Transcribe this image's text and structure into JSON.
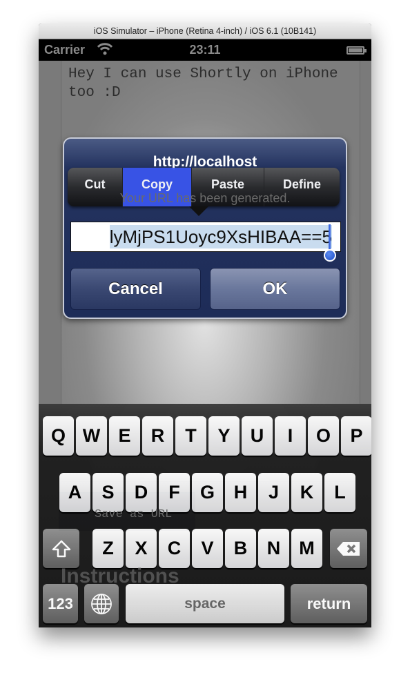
{
  "window": {
    "title": "iOS Simulator – iPhone (Retina 4-inch) / iOS 6.1 (10B141)"
  },
  "status_bar": {
    "carrier": "Carrier",
    "time": "23:11",
    "wifi_icon": "wifi-icon",
    "battery_icon": "battery-icon"
  },
  "background": {
    "text": "Hey I can use Shortly on iPhone too :D",
    "save_button": "Save as URL",
    "heading": "Instructions"
  },
  "alert": {
    "title": "http://localhost",
    "message": "Your URL has been generated.",
    "field_value": "lyMjPS1Uoyc9XsHIBAA==5",
    "cancel": "Cancel",
    "ok": "OK"
  },
  "edit_menu": {
    "items": [
      "Cut",
      "Copy",
      "Paste",
      "Define"
    ],
    "selected": "Copy",
    "selected_color": "#3a56f0"
  },
  "keyboard": {
    "row1": [
      "Q",
      "W",
      "E",
      "R",
      "T",
      "Y",
      "U",
      "I",
      "O",
      "P"
    ],
    "row2": [
      "A",
      "S",
      "D",
      "F",
      "G",
      "H",
      "J",
      "K",
      "L"
    ],
    "row3": [
      "Z",
      "X",
      "C",
      "V",
      "B",
      "N",
      "M"
    ],
    "numbers": "123",
    "space": "space",
    "return": "return"
  }
}
